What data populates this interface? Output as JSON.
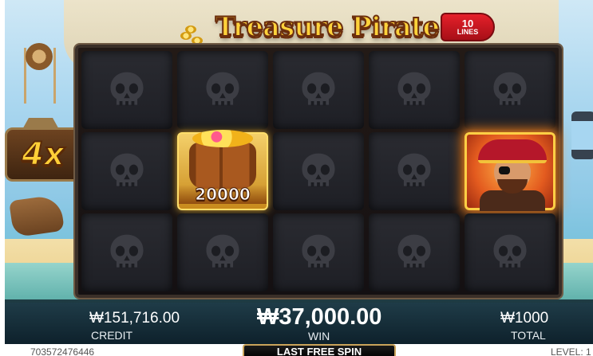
{
  "game": {
    "title": "Treasure Pirate",
    "lines_count": "10",
    "lines_label": "LINES",
    "multiplier": "4x"
  },
  "reels": {
    "rows": 3,
    "cols": 5,
    "cells": [
      {
        "symbol": "skull"
      },
      {
        "symbol": "skull"
      },
      {
        "symbol": "skull"
      },
      {
        "symbol": "skull"
      },
      {
        "symbol": "skull"
      },
      {
        "symbol": "skull"
      },
      {
        "symbol": "treasure-barrel",
        "value": "20000"
      },
      {
        "symbol": "skull"
      },
      {
        "symbol": "skull"
      },
      {
        "symbol": "pirate-captain"
      },
      {
        "symbol": "skull"
      },
      {
        "symbol": "skull"
      },
      {
        "symbol": "skull"
      },
      {
        "symbol": "skull"
      },
      {
        "symbol": "skull"
      }
    ]
  },
  "hud": {
    "credit_value": "₩151,716.00",
    "credit_label": "CREDIT",
    "win_value": "₩37,000.00",
    "win_label": "WIN",
    "total_value": "₩1000",
    "total_label": "TOTAL"
  },
  "footer": {
    "session_id": "703572476446",
    "last_spin_label": "LAST FREE SPIN",
    "level_label": "LEVEL: 1"
  },
  "colors": {
    "title_gold": "#ffd23a",
    "lines_red": "#e5202a",
    "pirate_glow": "#ff8c28",
    "barrel_gold": "#f4d06a"
  }
}
